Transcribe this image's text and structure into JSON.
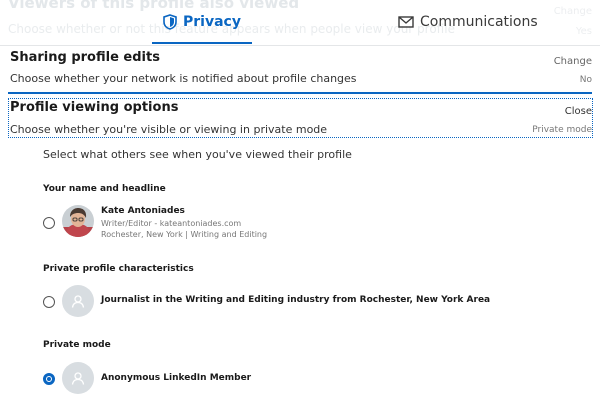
{
  "background_ghost": {
    "title": "Viewers of this profile also viewed",
    "subtitle": "Choose whether or not this feature appears when people view your profile",
    "right_top": "Change",
    "right_bottom": "Yes"
  },
  "tabs": [
    {
      "label": "Privacy",
      "icon": "shield-icon",
      "active": true
    },
    {
      "label": "Communications",
      "icon": "envelope-icon",
      "active": false
    }
  ],
  "sharing_section": {
    "title": "Sharing profile edits",
    "description": "Choose whether your network is notified about profile changes",
    "action": "Change",
    "value": "No"
  },
  "viewing_section": {
    "title": "Profile viewing options",
    "description": "Choose whether you're visible or viewing in private mode",
    "action": "Close",
    "value": "Private mode"
  },
  "select_prompt": "Select what others see when you've viewed their profile",
  "options": [
    {
      "group_label": "Your name and headline",
      "name": "Kate Antoniades",
      "sub1": "Writer/Editor - kateantoniades.com",
      "sub2": "Rochester, New York | Writing and Editing",
      "selected": false
    },
    {
      "group_label": "Private profile characteristics",
      "name": "Journalist in the Writing and Editing industry from Rochester, New York Area",
      "selected": false
    },
    {
      "group_label": "Private mode",
      "name": "Anonymous LinkedIn Member",
      "selected": true
    }
  ],
  "colors": {
    "accent": "#0a66c2",
    "avatar_gray": "#d8dde1"
  }
}
